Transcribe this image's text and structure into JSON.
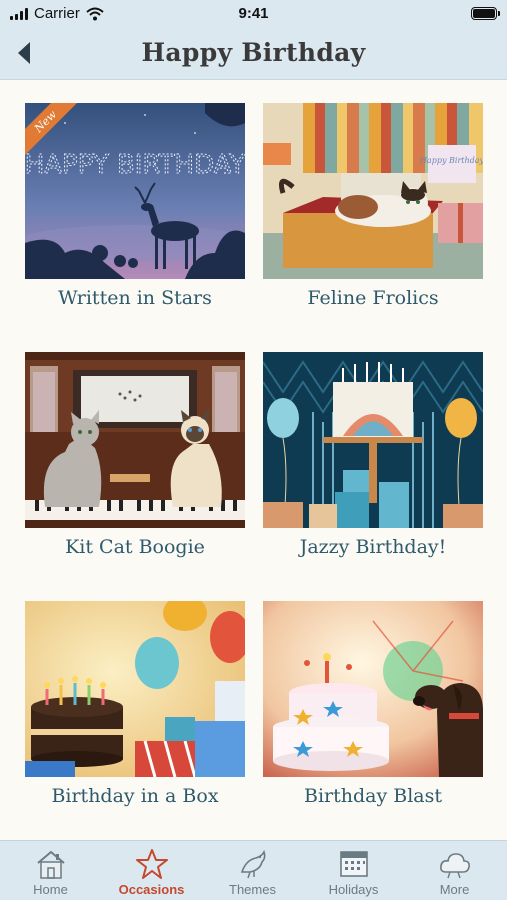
{
  "status_bar": {
    "carrier": "Carrier",
    "time": "9:41"
  },
  "nav": {
    "title": "Happy Birthday"
  },
  "cards": [
    {
      "title": "Written in Stars",
      "badge": "New",
      "art_text": "HAPPY BIRTHDAY"
    },
    {
      "title": "Feline Frolics",
      "art_text": "Happy Birthday"
    },
    {
      "title": "Kit Cat Boogie"
    },
    {
      "title": "Jazzy Birthday!"
    },
    {
      "title": "Birthday in a Box"
    },
    {
      "title": "Birthday Blast"
    }
  ],
  "tabs": [
    {
      "label": "Home",
      "icon": "house-icon"
    },
    {
      "label": "Occasions",
      "icon": "star-icon",
      "active": true
    },
    {
      "label": "Themes",
      "icon": "bird-icon"
    },
    {
      "label": "Holidays",
      "icon": "calendar-icon"
    },
    {
      "label": "More",
      "icon": "cloud-icon"
    }
  ],
  "colors": {
    "bar_bg": "#dce8ef",
    "accent": "#c4492e",
    "title_text": "#2f5a6c"
  }
}
